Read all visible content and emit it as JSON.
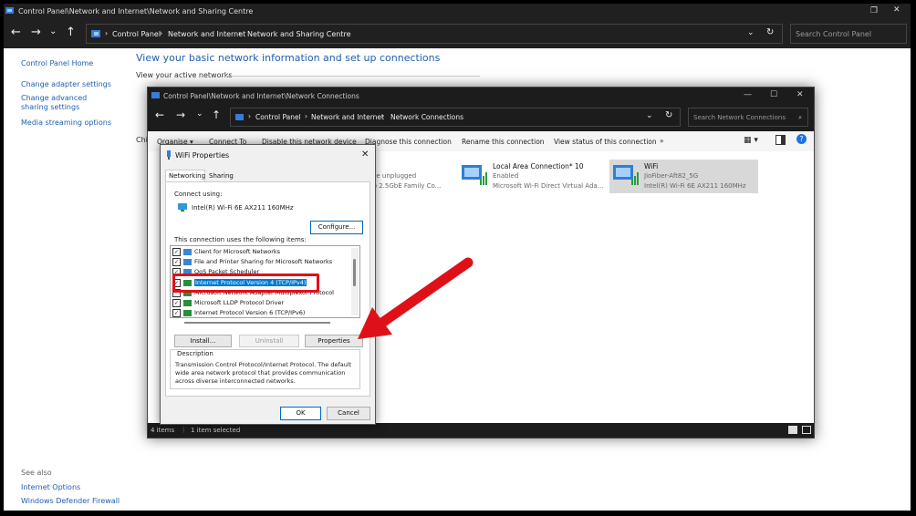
{
  "main_window": {
    "title": "Control Panel\\Network and Internet\\Network and Sharing Centre",
    "breadcrumbs": [
      "Control Panel",
      "Network and Internet",
      "Network and Sharing Centre"
    ],
    "search_placeholder": "Search Control Panel",
    "heading": "View your basic network information and set up connections",
    "active_networks_label": "View your active networks",
    "change_label_fragment": "Chi",
    "sidebar": {
      "home": "Control Panel Home",
      "links": [
        "Change adapter settings",
        "Change advanced sharing settings",
        "Media streaming options"
      ],
      "see_also_label": "See also",
      "see_also_links": [
        "Internet Options",
        "Windows Defender Firewall"
      ]
    }
  },
  "nc_window": {
    "title": "Control Panel\\Network and Internet\\Network Connections",
    "breadcrumbs": [
      "Control Panel",
      "Network and Internet",
      "Network Connections"
    ],
    "search_placeholder": "Search Network Connections",
    "commands": [
      "Organise ▾",
      "Connect To",
      "Disable this network device",
      "Diagnose this connection",
      "Rename this connection",
      "View status of this connection",
      "»"
    ],
    "adapters": [
      {
        "name": "",
        "status": "ble unplugged",
        "device": "ro 2.5GbE Family Co..."
      },
      {
        "name": "Local Area Connection* 10",
        "status": "Enabled",
        "device": "Microsoft Wi-Fi Direct Virtual Ada..."
      },
      {
        "name": "WiFi",
        "status": "JioFiber-Aft82_5G",
        "device": "Intel(R) Wi-Fi 6E AX211 160MHz"
      }
    ],
    "status_bar": {
      "items": "4 items",
      "selected": "1 item selected"
    }
  },
  "dialog": {
    "title": "WiFi Properties",
    "tabs": [
      "Networking",
      "Sharing"
    ],
    "connect_using_label": "Connect using:",
    "adapter_name": "Intel(R) Wi-Fi 6E AX211 160MHz",
    "configure_label": "Configure...",
    "items_label": "This connection uses the following items:",
    "items": [
      {
        "label": "Client for Microsoft Networks",
        "checked": true
      },
      {
        "label": "File and Printer Sharing for Microsoft Networks",
        "checked": true
      },
      {
        "label": "QoS Packet Scheduler",
        "checked": true
      },
      {
        "label": "Internet Protocol Version 4 (TCP/IPv4)",
        "checked": true,
        "selected": true
      },
      {
        "label": "Microsoft Network Adapter Multiplexor Protocol",
        "checked": false
      },
      {
        "label": "Microsoft LLDP Protocol Driver",
        "checked": true
      },
      {
        "label": "Internet Protocol Version 6 (TCP/IPv6)",
        "checked": true
      }
    ],
    "install_label": "Install...",
    "uninstall_label": "Uninstall",
    "properties_label": "Properties",
    "description_label": "Description",
    "description_text": "Transmission Control Protocol/Internet Protocol. The default wide area network protocol that provides communication across diverse interconnected networks.",
    "ok_label": "OK",
    "cancel_label": "Cancel"
  },
  "colors": {
    "highlight": "#e01018",
    "selection": "#0078d7",
    "link": "#1f5fb0"
  }
}
